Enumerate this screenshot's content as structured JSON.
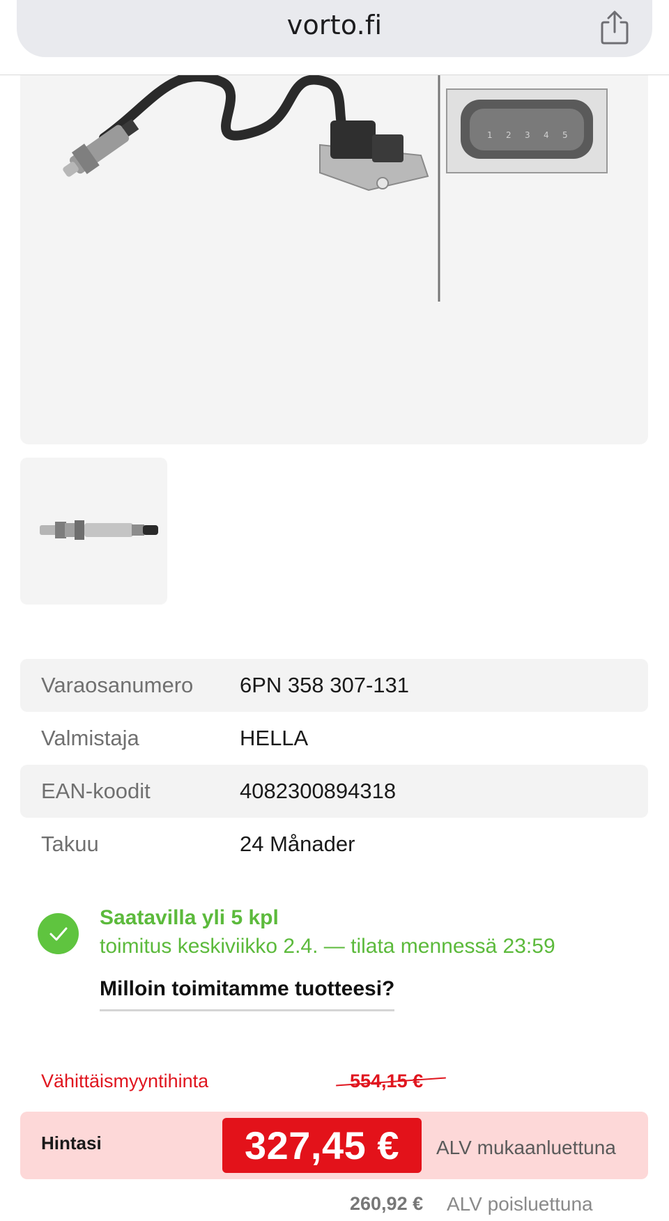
{
  "browser": {
    "url": "vorto.fi",
    "share_icon": "share-icon"
  },
  "product": {
    "main_image": "nox-sensor-image",
    "thumbnail": "nox-sensor-thumbnail",
    "connector_pin_labels": [
      "1",
      "2",
      "3",
      "4",
      "5"
    ]
  },
  "specs": [
    {
      "label": "Varaosanumero",
      "value": "6PN 358 307-131"
    },
    {
      "label": "Valmistaja",
      "value": "HELLA"
    },
    {
      "label": "EAN-koodit",
      "value": "4082300894318"
    },
    {
      "label": "Takuu",
      "value": "24 Månader"
    }
  ],
  "availability": {
    "title": "Saatavilla yli 5 kpl",
    "subtitle": "toimitus keskiviikko 2.4. — tilata mennessä 23:59",
    "link": "Milloin toimitamme tuotteesi?",
    "icon": "check-icon",
    "color": "#5cba3c"
  },
  "pricing": {
    "retail_label": "Vähittäismyyntihinta",
    "retail_price": "554,15 €",
    "your_price_label": "Hintasi",
    "your_price": "327,45 €",
    "incl_vat_label": "ALV mukaanluettuna",
    "net_price": "260,92 €",
    "excl_vat_label": "ALV poisluettuna",
    "accent_color": "#e3121a"
  }
}
